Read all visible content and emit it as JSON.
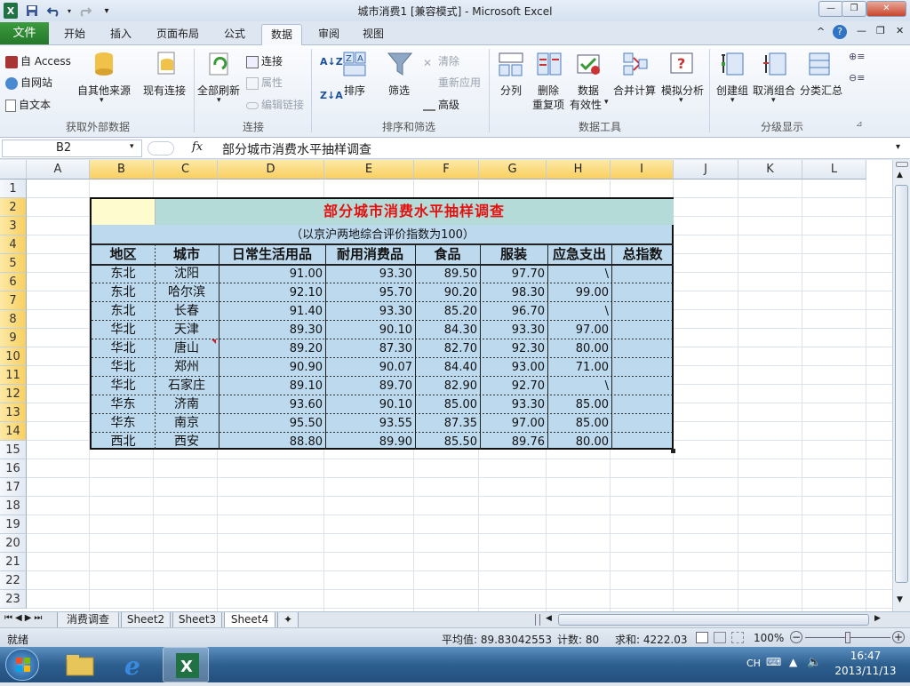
{
  "window": {
    "title": "城市消费1  [兼容模式] - Microsoft Excel"
  },
  "tabs": [
    "开始",
    "插入",
    "页面布局",
    "公式",
    "数据",
    "审阅",
    "视图"
  ],
  "file_tab": "文件",
  "active_tab": "数据",
  "ribbon": {
    "get_external": {
      "access": "自 Access",
      "web": "自网站",
      "text": "自文本",
      "other": "自其他来源",
      "existing": "现有连接",
      "label": "获取外部数据"
    },
    "connections": {
      "refresh": "全部刷新",
      "connections": "连接",
      "properties": "属性",
      "edit_links": "编辑链接",
      "label": "连接"
    },
    "sort_filter": {
      "sort": "排序",
      "filter": "筛选",
      "clear": "清除",
      "reapply": "重新应用",
      "advanced": "高级",
      "label": "排序和筛选"
    },
    "data_tools": {
      "text_to_columns": "分列",
      "remove_dup_1": "删除",
      "remove_dup_2": "重复项",
      "validation_1": "数据",
      "validation_2": "有效性",
      "consolidate": "合并计算",
      "whatif": "模拟分析",
      "label": "数据工具"
    },
    "outline": {
      "group": "创建组",
      "ungroup": "取消组合",
      "subtotal": "分类汇总",
      "label": "分级显示"
    }
  },
  "formula_bar": {
    "name_box": "B2",
    "fx": "fx",
    "content": "部分城市消费水平抽样调查"
  },
  "columns": [
    "A",
    "B",
    "C",
    "D",
    "E",
    "F",
    "G",
    "H",
    "I",
    "J",
    "K",
    "L"
  ],
  "rows": [
    "1",
    "2",
    "3",
    "4",
    "5",
    "6",
    "7",
    "8",
    "9",
    "10",
    "11",
    "12",
    "13",
    "14",
    "15",
    "16",
    "17",
    "18",
    "19",
    "20",
    "21",
    "22",
    "23"
  ],
  "table": {
    "title": "部分城市消费水平抽样调查",
    "subtitle": "（以京沪两地综合评价指数为100）",
    "headers": [
      "地区",
      "城市",
      "日常生活用品",
      "耐用消费品",
      "食品",
      "服装",
      "应急支出",
      "总指数"
    ],
    "data": [
      [
        "东北",
        "沈阳",
        "91.00",
        "93.30",
        "89.50",
        "97.70",
        "\\",
        ""
      ],
      [
        "东北",
        "哈尔滨",
        "92.10",
        "95.70",
        "90.20",
        "98.30",
        "99.00",
        ""
      ],
      [
        "东北",
        "长春",
        "91.40",
        "93.30",
        "85.20",
        "96.70",
        "\\",
        ""
      ],
      [
        "华北",
        "天津",
        "89.30",
        "90.10",
        "84.30",
        "93.30",
        "97.00",
        ""
      ],
      [
        "华北",
        "唐山",
        "89.20",
        "87.30",
        "82.70",
        "92.30",
        "80.00",
        ""
      ],
      [
        "华北",
        "郑州",
        "90.90",
        "90.07",
        "84.40",
        "93.00",
        "71.00",
        ""
      ],
      [
        "华北",
        "石家庄",
        "89.10",
        "89.70",
        "82.90",
        "92.70",
        "\\",
        ""
      ],
      [
        "华东",
        "济南",
        "93.60",
        "90.10",
        "85.00",
        "93.30",
        "85.00",
        ""
      ],
      [
        "华东",
        "南京",
        "95.50",
        "93.55",
        "87.35",
        "97.00",
        "85.00",
        ""
      ],
      [
        "西北",
        "西安",
        "88.80",
        "89.90",
        "85.50",
        "89.76",
        "80.00",
        ""
      ]
    ]
  },
  "sheet_tabs": [
    "消费调查",
    "Sheet2",
    "Sheet3",
    "Sheet4"
  ],
  "active_sheet": "Sheet4",
  "status": {
    "ready": "就绪",
    "average": "平均值: 89.83042553",
    "count": "计数: 80",
    "sum": "求和: 4222.03",
    "zoom": "100%"
  },
  "taskbar": {
    "lang": "CH",
    "time": "16:47",
    "date": "2013/11/13"
  }
}
